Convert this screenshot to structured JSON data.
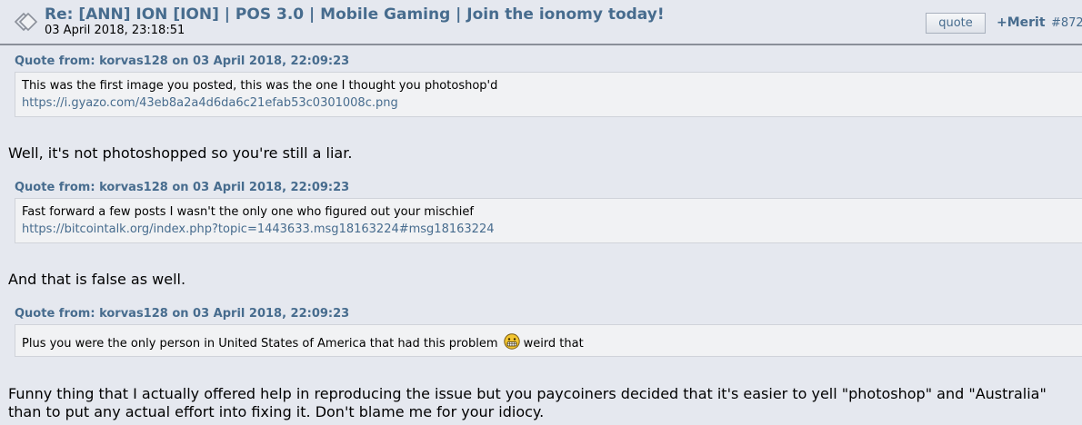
{
  "post": {
    "title": "Re: [ANN] ION [ION] | POS 3.0 | Mobile Gaming | Join the ionomy today!",
    "date": "03 April 2018, 23:18:51",
    "quote_label": "quote",
    "merit_label": "+Merit",
    "post_number": "#872"
  },
  "quotes": [
    {
      "header": "Quote from: korvas128 on 03 April 2018, 22:09:23",
      "text": "This was the first image you posted, this was the one I thought you photoshop'd",
      "link": "https://i.gyazo.com/43eb8a2a4d6da6c21efab53c0301008c.png"
    },
    {
      "header": "Quote from: korvas128 on 03 April 2018, 22:09:23",
      "text": "Fast forward a few posts I wasn't the only one who figured out your mischief",
      "link": "https://bitcointalk.org/index.php?topic=1443633.msg18163224#msg18163224"
    },
    {
      "header": "Quote from: korvas128 on 03 April 2018, 22:09:23",
      "text_before": "Plus you were the only person in United States of America that had this problem",
      "emoji_icon": "grimacing-face-icon",
      "text_after": "weird that"
    }
  ],
  "replies": [
    "Well, it's not photoshopped so you're still a liar.",
    "And that is false as well.",
    "Funny thing that I actually offered help in reproducing the issue but you paycoiners decided that it's easier to yell \"photoshop\" and \"Australia\" than to put any actual effort into fixing it. Don't blame me for your idiocy."
  ],
  "colors": {
    "page_bg": "#e5e8ef",
    "link": "#476c8e",
    "quote_bg": "#f1f2f4"
  }
}
